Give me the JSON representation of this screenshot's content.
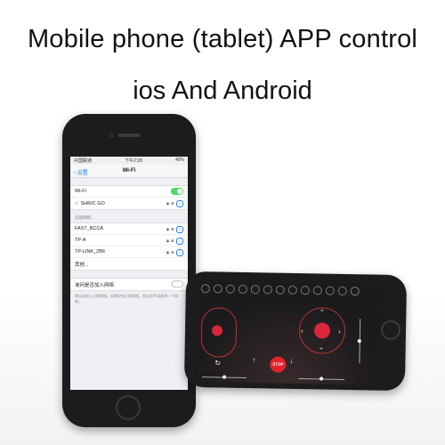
{
  "headline": "Mobile phone (tablet) APP control",
  "subline": "ios And Android",
  "portrait_phone": {
    "status": {
      "carrier": "中国联通",
      "time": "下午2:28",
      "battery": "40%"
    },
    "nav": {
      "back_label": "设置",
      "title": "Wi-Fi"
    },
    "wifi": {
      "label": "Wi-Fi",
      "enabled": true,
      "connected_network": "SHR/C GO"
    },
    "networks_section_label": "选取网络...",
    "networks": [
      "FAST_BCCA",
      "TP-A",
      "TP-LINK_2B6",
      "其他..."
    ],
    "ask_join": {
      "label": "询问是否加入网络",
      "enabled": false,
      "note": "将自动加入已知网络。如果没有已知网络，您必须手动选择一个网络。"
    }
  },
  "landscape_phone": {
    "stop_label": "STOP"
  },
  "colors": {
    "accent_blue": "#1a7cf5",
    "toggle_green": "#4cd964",
    "app_red": "#d9263c",
    "phone_body": "#1c1c1e"
  }
}
